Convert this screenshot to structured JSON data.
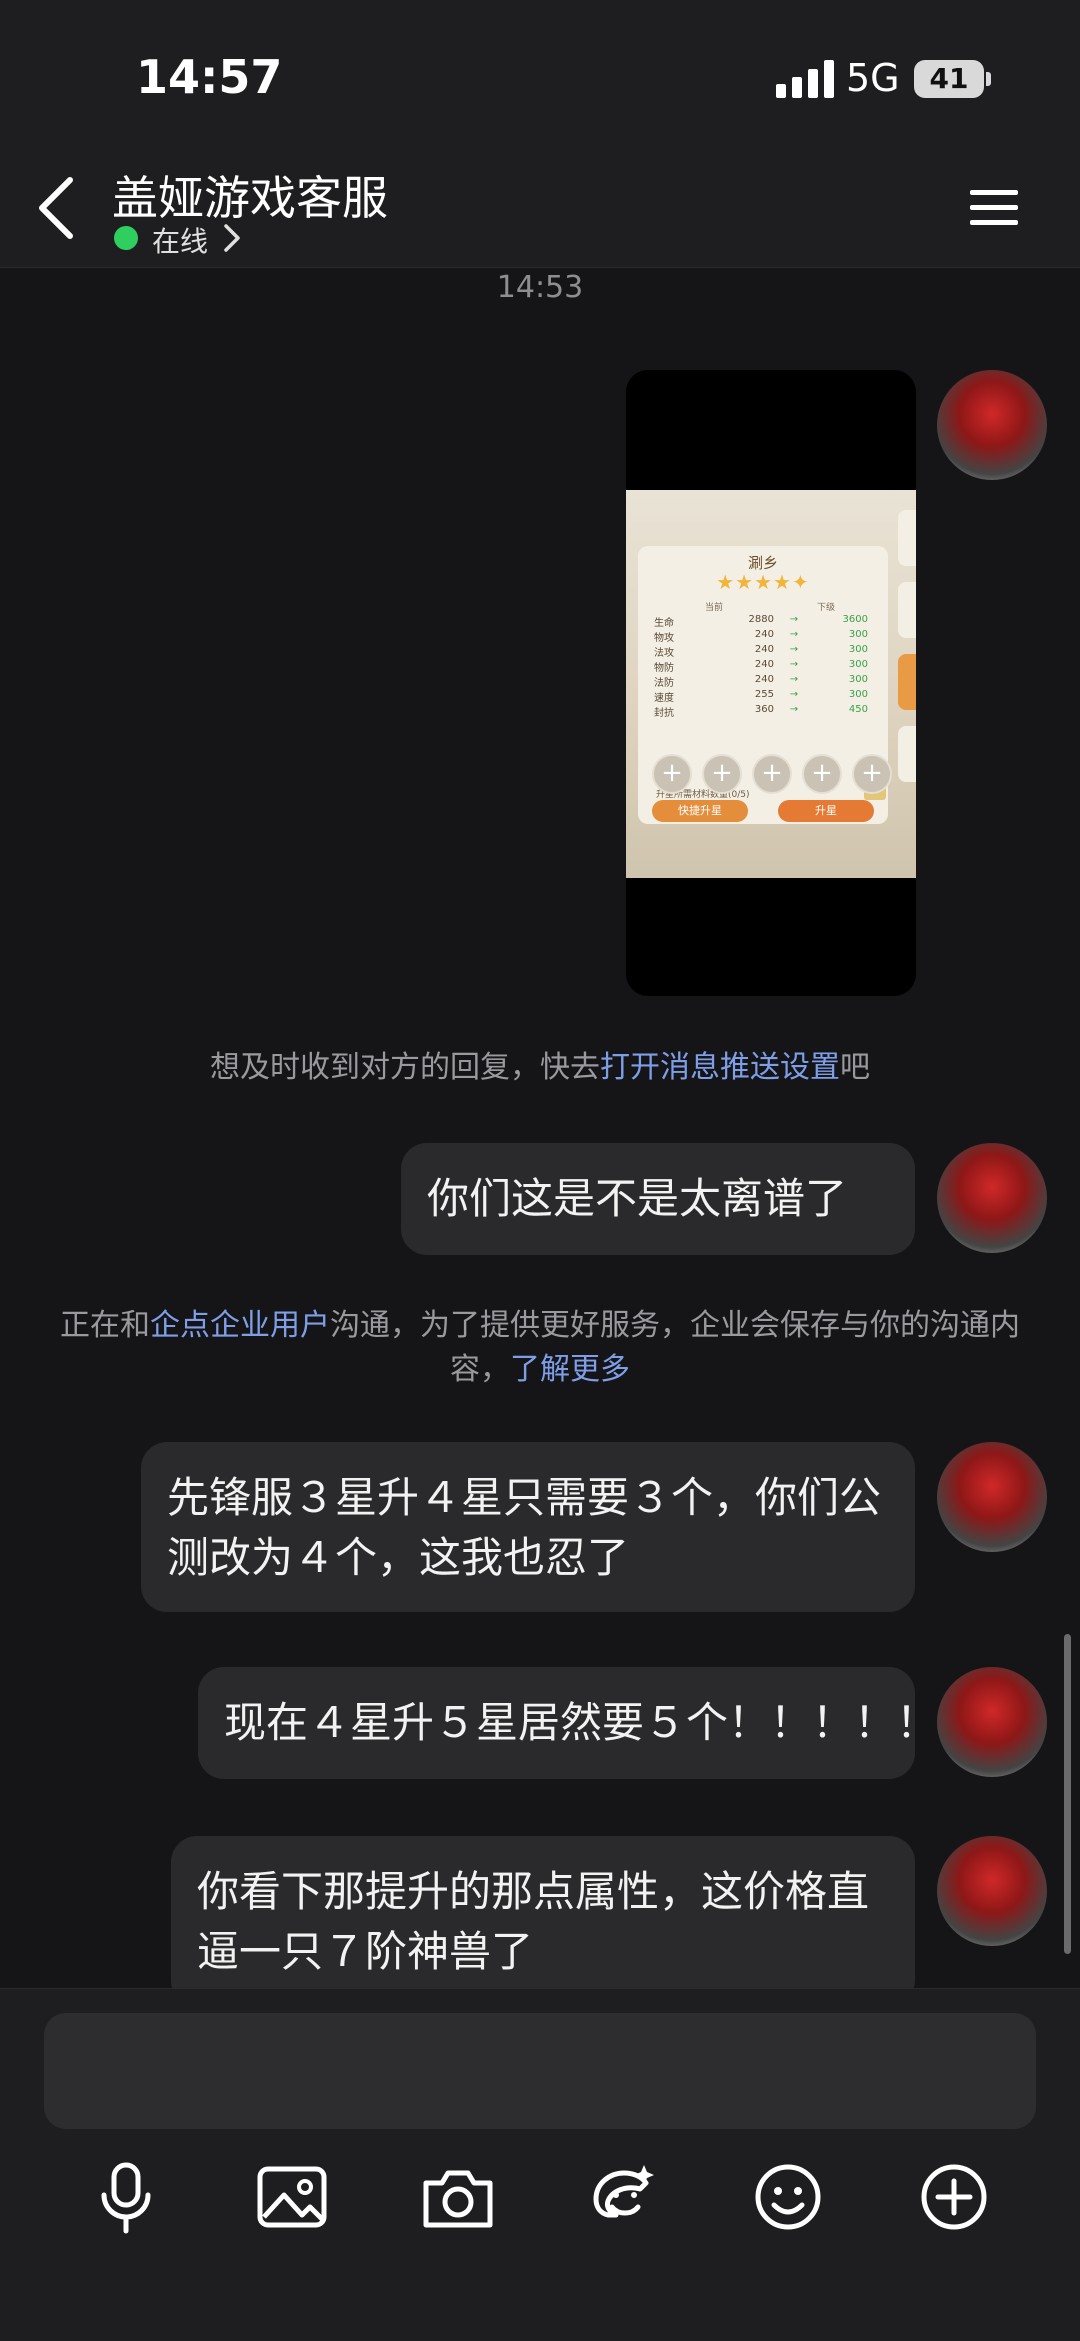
{
  "status_bar": {
    "time": "14:57",
    "network": "5G",
    "battery": "41"
  },
  "header": {
    "title": "盖娅游戏客服",
    "status_label": "在线"
  },
  "timestamp": "14:53",
  "image_message": {
    "card_title": "涮乡",
    "stars": "★★★★✦",
    "col_current": "当前",
    "col_next": "下级",
    "stats": [
      {
        "name": "生命",
        "current": "2880",
        "arrow": "→",
        "next": "3600"
      },
      {
        "name": "物攻",
        "current": "240",
        "arrow": "→",
        "next": "300"
      },
      {
        "name": "法攻",
        "current": "240",
        "arrow": "→",
        "next": "300"
      },
      {
        "name": "物防",
        "current": "240",
        "arrow": "→",
        "next": "300"
      },
      {
        "name": "法防",
        "current": "240",
        "arrow": "→",
        "next": "300"
      },
      {
        "name": "速度",
        "current": "255",
        "arrow": "→",
        "next": "300"
      },
      {
        "name": "封抗",
        "current": "360",
        "arrow": "→",
        "next": "450"
      }
    ],
    "materials_label": "升星所需材料数量(0/5)",
    "materials_btn": "±",
    "slot_symbol": "+",
    "quick_upgrade": "快捷升星",
    "upgrade": "升星"
  },
  "push_notice": {
    "prefix": "想及时收到对方的回复，快去",
    "link": "打开消息推送设置",
    "suffix": "吧"
  },
  "enterprise_notice": {
    "prefix": "正在和",
    "link1": "企点企业用户",
    "middle": "沟通，为了提供更好服务，企业会保存与你的沟通内容，",
    "link2": "了解更多"
  },
  "messages": [
    {
      "text": "你们这是不是太离谱了"
    },
    {
      "text": "先锋服３星升４星只需要３个，你们公测改为４个，这我也忍了"
    },
    {
      "text": "现在４星升５星居然要５个！！！！！"
    },
    {
      "text": "你看下那提升的那点属性，这价格直逼一只７阶神兽了"
    }
  ],
  "toolbar": [
    "microphone-icon",
    "image-icon",
    "camera-icon",
    "sticker-icon",
    "emoji-icon",
    "add-icon"
  ],
  "colors": {
    "background": "#151517",
    "bubble": "#2a2a2c",
    "link": "#7e9ee8",
    "online": "#2fcf5f"
  }
}
